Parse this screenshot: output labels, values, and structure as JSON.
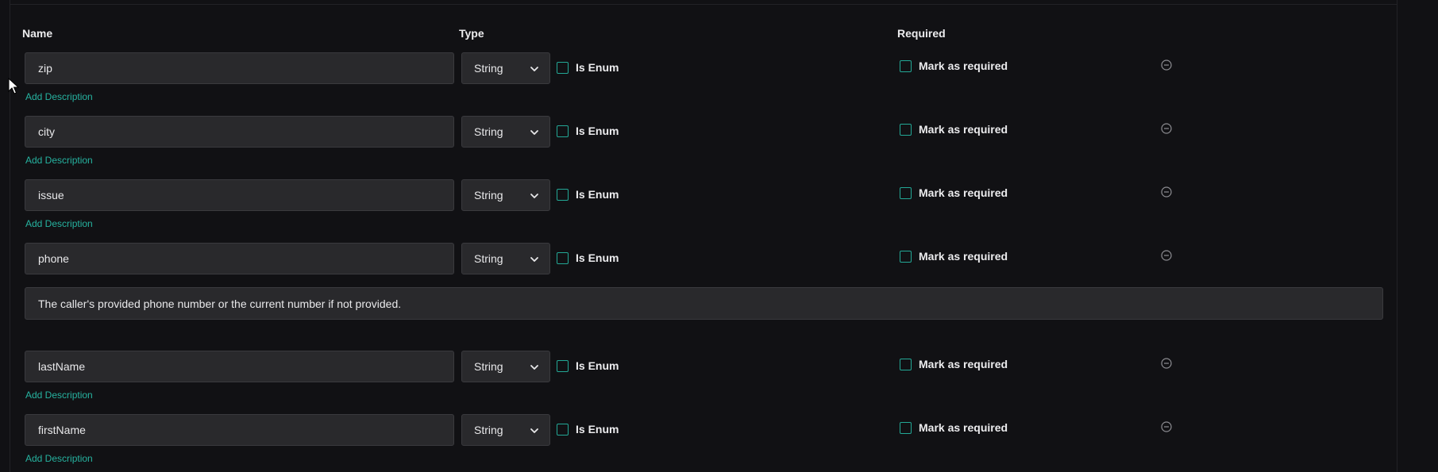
{
  "headers": {
    "name": "Name",
    "type": "Type",
    "required": "Required"
  },
  "labels": {
    "is_enum": "Is Enum",
    "mark_required": "Mark as required",
    "add_description": "Add Description"
  },
  "icons": {
    "dropdown": "chevron-down-icon",
    "remove": "minus-circle-icon",
    "cursor": "mouse-pointer-icon"
  },
  "colors": {
    "accent": "#26b3a0",
    "background": "#111114",
    "input_bg": "#29292c"
  },
  "properties": [
    {
      "name": "zip",
      "type": "String",
      "is_enum": false,
      "required": false,
      "description": null
    },
    {
      "name": "city",
      "type": "String",
      "is_enum": false,
      "required": false,
      "description": null
    },
    {
      "name": "issue",
      "type": "String",
      "is_enum": false,
      "required": false,
      "description": null
    },
    {
      "name": "phone",
      "type": "String",
      "is_enum": false,
      "required": false,
      "description": "The caller's provided phone number or the current number if not provided."
    },
    {
      "name": "lastName",
      "type": "String",
      "is_enum": false,
      "required": false,
      "description": null
    },
    {
      "name": "firstName",
      "type": "String",
      "is_enum": false,
      "required": false,
      "description": null
    }
  ]
}
